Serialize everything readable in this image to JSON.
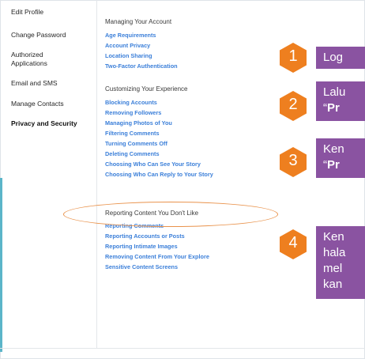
{
  "sidebar": {
    "items": [
      {
        "label": "Edit Profile"
      },
      {
        "label": "Change Password"
      },
      {
        "label": "Authorized Applications"
      },
      {
        "label": "Email and SMS"
      },
      {
        "label": "Manage Contacts"
      },
      {
        "label": "Privacy and Security"
      }
    ]
  },
  "content": {
    "sections": [
      {
        "title": "Managing Your Account",
        "links": [
          "Age Requirements",
          "Account Privacy",
          "Location Sharing",
          "Two-Factor Authentication"
        ]
      },
      {
        "title": "Customizing Your Experience",
        "links": [
          "Blocking Accounts",
          "Removing Followers",
          "Managing Photos of You",
          "Filtering Comments",
          "Turning Comments Off",
          "Deleting Comments",
          "Choosing Who Can See Your Story",
          "Choosing Who Can Reply to Your Story"
        ]
      },
      {
        "title": "Reporting Content You Don't Like",
        "links": [
          "Reporting Comments",
          "Reporting Accounts or Posts",
          "Reporting Intimate Images",
          "Removing Content From Your Explore",
          "Sensitive Content Screens"
        ]
      }
    ]
  },
  "steps": [
    {
      "number": "1",
      "text_lines": [
        "Log"
      ]
    },
    {
      "number": "2",
      "text_lines": [
        "Lalu",
        "“",
        "Pr"
      ]
    },
    {
      "number": "3",
      "text_lines": [
        "Ken",
        "“",
        "Pr"
      ]
    },
    {
      "number": "4",
      "text_lines": [
        "Ken",
        "hala",
        "mel",
        "kan"
      ]
    }
  ],
  "colors": {
    "callout": "#8a53a1",
    "badge": "#ee7f1f",
    "link": "#3b7fd9",
    "highlight": "#e9924b"
  }
}
